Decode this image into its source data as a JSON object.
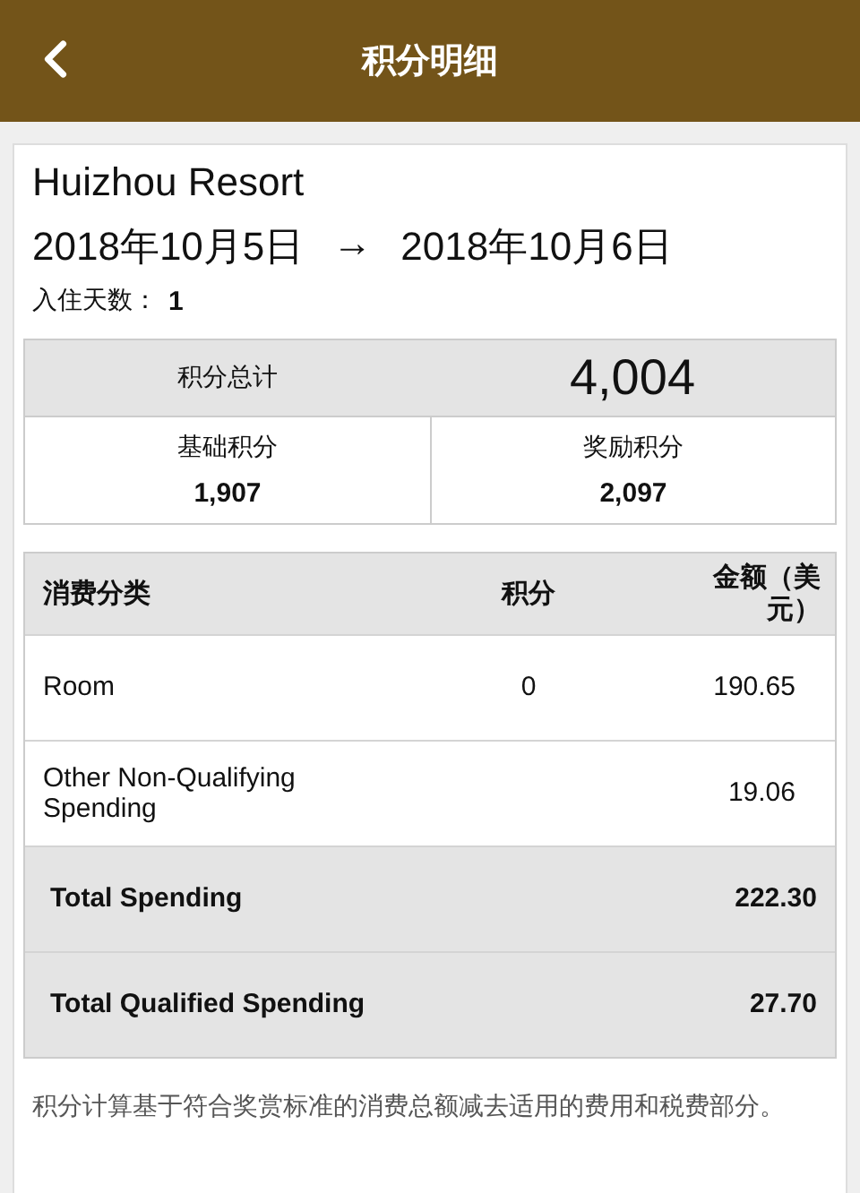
{
  "header": {
    "title": "积分明细"
  },
  "stay": {
    "hotel": "Huizhou Resort",
    "check_in": "2018年10月5日",
    "arrow": "→",
    "check_out": "2018年10月6日",
    "nights_label": "入住天数：",
    "nights": "1"
  },
  "summary": {
    "total_label": "积分总计",
    "total": "4,004",
    "parts": [
      {
        "label": "基础积分",
        "value": "1,907"
      },
      {
        "label": "奖励积分",
        "value": "2,097"
      }
    ]
  },
  "spending": {
    "columns": [
      "消费分类",
      "积分",
      "金额（美元）"
    ],
    "rows": [
      {
        "kind": "item",
        "category": "Room",
        "points": "0",
        "amount": "190.65"
      },
      {
        "kind": "item",
        "category": "Other Non-Qualifying Spending",
        "amount": "19.06"
      },
      {
        "kind": "total",
        "category": "Total Spending",
        "amount": "222.30"
      },
      {
        "kind": "total",
        "category": "Total Qualified Spending",
        "amount": "27.70"
      }
    ]
  },
  "note": "积分计算基于符合奖赏标准的消费总额减去适用的费用和税费部分。"
}
